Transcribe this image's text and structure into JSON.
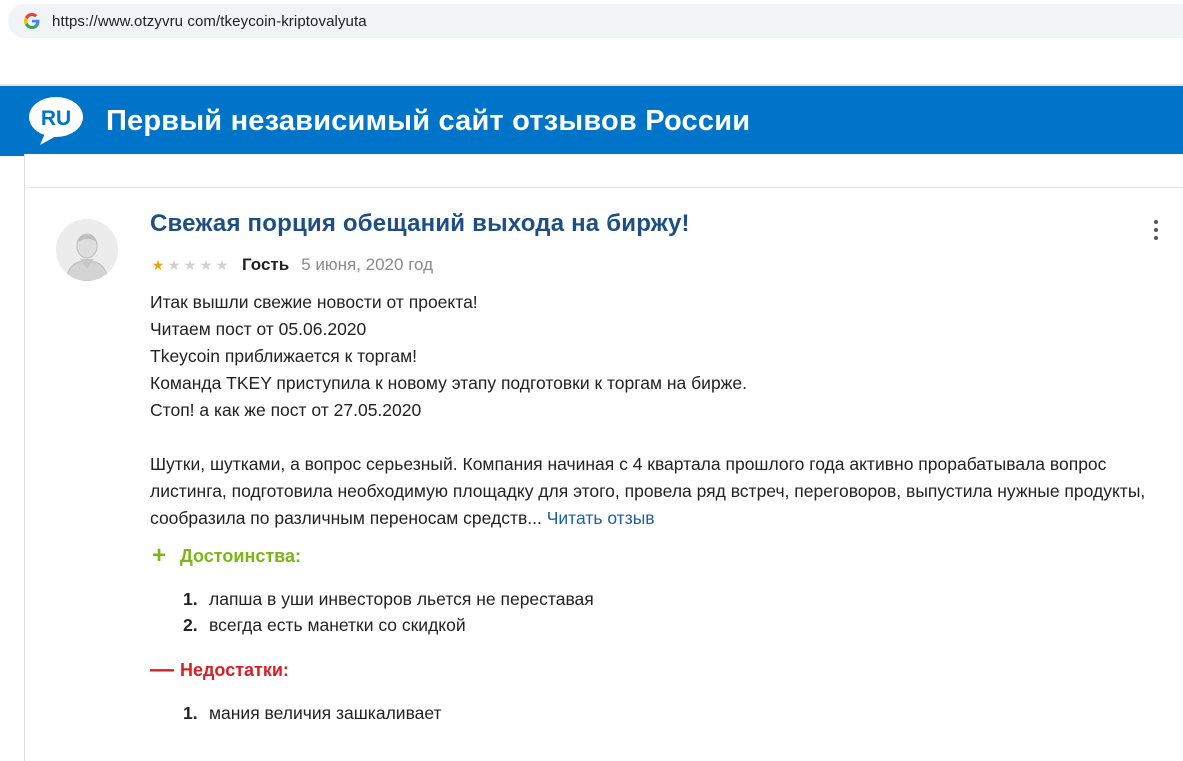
{
  "browser": {
    "url": "https://www.otzyvru com/tkeycoin-kriptovalyuta"
  },
  "site": {
    "logo_text": "RU",
    "title": "Первый независимый сайт отзывов России",
    "header_color": "#0074c8"
  },
  "review": {
    "title": "Свежая порция обещаний выхода на биржу!",
    "rating": 1,
    "rating_max": 5,
    "author": "Гость",
    "date": "5 июня, 2020 год",
    "body_lines": [
      "Итак вышли свежие новости от проекта!",
      "Читаем пост от 05.06.2020",
      "Tkeycoin приближается к торгам!",
      "Команда TKEY приступила к новому этапу подготовки к торгам на бирже.",
      "Стоп! а как же пост от 27.05.2020"
    ],
    "paragraph2": "Шутки, шутками, а вопрос серьезный. Компания начиная с 4 квартала прошлого года активно прорабатывала вопрос листинга, подготовила необходимую площадку для этого, провела ряд встреч, переговоров, выпустила нужные продукты, сообразила по различным переносам средств...",
    "read_more": "Читать отзыв",
    "pros": {
      "label": "Достоинства:",
      "sign": "+",
      "color": "#7cb518",
      "items": [
        {
          "num": "1.",
          "text": "лапша в уши инвесторов льется не переставая"
        },
        {
          "num": "2.",
          "text": "всегда есть манетки со скидкой"
        }
      ]
    },
    "cons": {
      "label": "Недостатки:",
      "sign": "—",
      "color": "#d61f26",
      "items": [
        {
          "num": "1.",
          "text": "мания величия зашкаливает"
        }
      ]
    }
  },
  "icons": {
    "google": "google-g-icon",
    "logo": "speech-bubble-logo-icon",
    "avatar": "user-avatar-icon",
    "menu": "more-vertical-icon",
    "star_filled": "star-filled-icon",
    "star_empty": "star-empty-icon"
  }
}
